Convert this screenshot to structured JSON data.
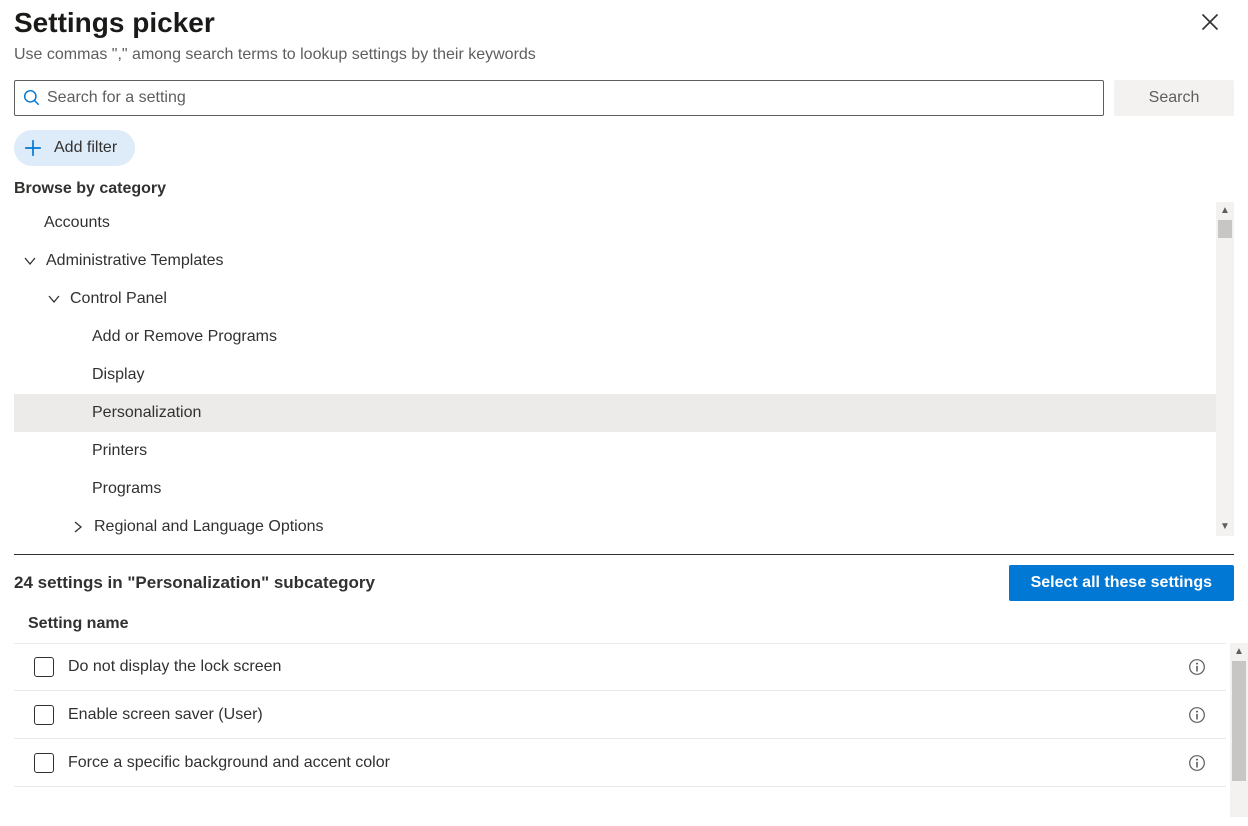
{
  "header": {
    "title": "Settings picker",
    "subtitle": "Use commas \",\" among search terms to lookup settings by their keywords"
  },
  "search": {
    "placeholder": "Search for a setting",
    "button_label": "Search"
  },
  "add_filter_label": "Add filter",
  "browse_label": "Browse by category",
  "tree": {
    "rows": [
      {
        "label": "Accounts"
      },
      {
        "label": "Administrative Templates"
      },
      {
        "label": "Control Panel"
      },
      {
        "label": "Add or Remove Programs"
      },
      {
        "label": "Display"
      },
      {
        "label": "Personalization"
      },
      {
        "label": "Printers"
      },
      {
        "label": "Programs"
      },
      {
        "label": "Regional and Language Options"
      }
    ]
  },
  "settings": {
    "count_text": "24 settings in \"Personalization\" subcategory",
    "select_all_label": "Select all these settings",
    "column_header": "Setting name",
    "rows": [
      {
        "label": "Do not display the lock screen"
      },
      {
        "label": "Enable screen saver (User)"
      },
      {
        "label": "Force a specific background and accent color"
      }
    ]
  }
}
